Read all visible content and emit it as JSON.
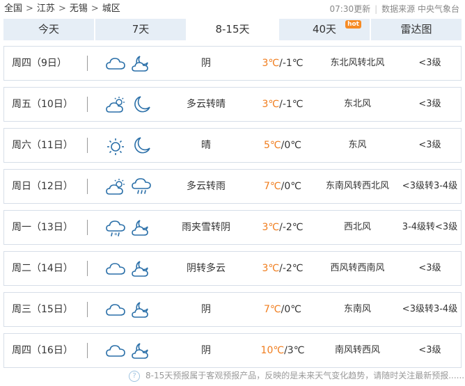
{
  "breadcrumb": {
    "items": [
      "全国",
      "江苏",
      "无锡"
    ],
    "separator": ">",
    "current": "城区"
  },
  "meta": {
    "update_time": "07:30更新",
    "source": "数据来源 中央气象台"
  },
  "tabs": [
    {
      "label": "今天"
    },
    {
      "label": "7天"
    },
    {
      "label": "8-15天",
      "active": true
    },
    {
      "label": "40天",
      "badge": "hot"
    },
    {
      "label": "雷达图"
    }
  ],
  "forecast": [
    {
      "day": "周四（9日）",
      "day_icon": "cloud-icon",
      "night_icon": "partly-cloudy-night-icon",
      "desc": "阴",
      "high": "3℃",
      "low": "/-1℃",
      "wind": "东北风转北风",
      "level": "<3级"
    },
    {
      "day": "周五（10日）",
      "day_icon": "partly-cloudy-day-icon",
      "night_icon": "moon-icon",
      "desc": "多云转晴",
      "high": "3℃",
      "low": "/-1℃",
      "wind": "东北风",
      "level": "<3级"
    },
    {
      "day": "周六（11日）",
      "day_icon": "sun-icon",
      "night_icon": "moon-icon",
      "desc": "晴",
      "high": "5℃",
      "low": "/0℃",
      "wind": "东风",
      "level": "<3级"
    },
    {
      "day": "周日（12日）",
      "day_icon": "partly-cloudy-day-icon",
      "night_icon": "rain-icon",
      "desc": "多云转雨",
      "high": "7℃",
      "low": "/0℃",
      "wind": "东南风转西北风",
      "level": "<3级转3-4级"
    },
    {
      "day": "周一（13日）",
      "day_icon": "sleet-icon",
      "night_icon": "partly-cloudy-night-icon",
      "desc": "雨夹雪转阴",
      "high": "3℃",
      "low": "/-2℃",
      "wind": "西北风",
      "level": "3-4级转<3级"
    },
    {
      "day": "周二（14日）",
      "day_icon": "cloud-icon",
      "night_icon": "partly-cloudy-night-icon",
      "desc": "阴转多云",
      "high": "3℃",
      "low": "/-2℃",
      "wind": "西风转西南风",
      "level": "<3级"
    },
    {
      "day": "周三（15日）",
      "day_icon": "cloud-icon",
      "night_icon": "partly-cloudy-night-icon",
      "desc": "阴",
      "high": "7℃",
      "low": "/0℃",
      "wind": "东南风",
      "level": "<3级转3-4级"
    },
    {
      "day": "周四（16日）",
      "day_icon": "cloud-icon",
      "night_icon": "partly-cloudy-night-icon",
      "desc": "阴",
      "high": "10℃",
      "low": "/3℃",
      "wind": "南风转西风",
      "level": "<3级"
    }
  ],
  "footer": {
    "note": "8-15天预报属于客观预报产品，反映的是未来天气变化趋势，请随时关注最新预报......"
  },
  "colors": {
    "high_temp": "#f07c1c",
    "icon_stroke": "#2a6fa8",
    "tab_bg": "#e6eef6",
    "hot_badge": "#f68b24"
  }
}
